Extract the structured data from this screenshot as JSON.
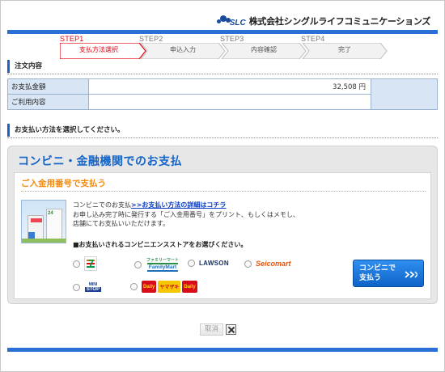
{
  "header": {
    "logo_mark": "SLC",
    "company": "株式会社シングルライフコミュニケーションズ"
  },
  "steps": [
    {
      "num": "STEP1",
      "label": "支払方法選択",
      "active": true
    },
    {
      "num": "STEP2",
      "label": "申込入力",
      "active": false
    },
    {
      "num": "STEP3",
      "label": "内容確認",
      "active": false
    },
    {
      "num": "STEP4",
      "label": "完了",
      "active": false
    }
  ],
  "order": {
    "heading": "注文内容",
    "rows": [
      {
        "label": "お支払金額",
        "value": "32,508 円"
      },
      {
        "label": "ご利用内容",
        "value": ""
      }
    ]
  },
  "payment": {
    "heading": "お支払い方法を選択してください。",
    "panel_title": "コンビニ・金融機関でのお支払",
    "sub_title": "ご入金用番号で支払う",
    "desc_line1_prefix": "コンビニでのお支払",
    "desc_link": ">>お支払い方法の詳細はコチラ",
    "desc_line2": "お申し込み完了時に発行する「ご入金用番号」をプリント、もしくはメモし、",
    "desc_line3": "店舗にてお支払いいただけます。",
    "choose_label": "■お支払いされるコンビニエンスストアをお選びください。",
    "stores": {
      "seven_eleven": {
        "name": "7",
        "sub": ""
      },
      "familymart": {
        "line1": "ファミリーマート",
        "line2": "FamilyMart"
      },
      "lawson": "LAWSON",
      "seicomart": "Seicomart",
      "ministop": {
        "line1": "MINI",
        "line2": "STOP"
      },
      "daily": [
        "Daily",
        "ヤマザキ",
        "Daily"
      ]
    },
    "pay_button_line1": "コンビニで",
    "pay_button_line2": "支払う",
    "pay_button_arrow": "»"
  },
  "cancel_label": "取消",
  "colors": {
    "accent_blue": "#2a6fd6",
    "active_step": "#e60012",
    "sub_title_orange": "#ef8a10",
    "table_header": "#d7e5f5"
  }
}
